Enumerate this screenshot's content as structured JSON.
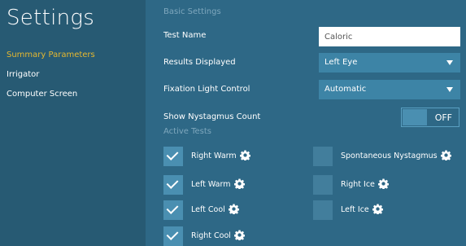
{
  "sidebar": {
    "title": "Settings",
    "items": [
      {
        "label": "Summary Parameters",
        "active": true
      },
      {
        "label": "Irrigator",
        "active": false
      },
      {
        "label": "Computer Screen",
        "active": false
      }
    ]
  },
  "basic_settings": {
    "section_label": "Basic Settings",
    "test_name": {
      "label": "Test Name",
      "value": "Caloric"
    },
    "results_displayed": {
      "label": "Results Displayed",
      "value": "Left Eye"
    },
    "fixation_light": {
      "label": "Fixation Light Control",
      "value": "Automatic"
    },
    "nystagmus_count": {
      "label": "Show Nystagmus Count",
      "state": "OFF"
    }
  },
  "active_tests": {
    "section_label": "Active Tests",
    "tests": [
      {
        "label": "Right Warm",
        "checked": true
      },
      {
        "label": "Left Warm",
        "checked": true
      },
      {
        "label": "Left Cool",
        "checked": true
      },
      {
        "label": "Right Cool",
        "checked": true
      },
      {
        "label": "Spontaneous Nystagmus",
        "checked": false
      },
      {
        "label": "Right Ice",
        "checked": false
      },
      {
        "label": "Left Ice",
        "checked": false
      }
    ]
  },
  "colors": {
    "sidebar_bg": "#275a73",
    "main_bg": "#2e6886",
    "accent": "#e5b830",
    "control_bg": "#3d84a6"
  }
}
